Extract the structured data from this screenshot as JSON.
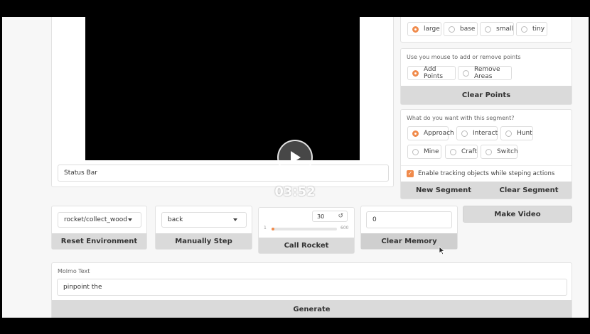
{
  "video": {
    "time": "03:52",
    "play_icon": "play-icon"
  },
  "status": {
    "placeholder_text": "Status Bar"
  },
  "model_size": {
    "options": [
      {
        "label": "large",
        "selected": true
      },
      {
        "label": "base",
        "selected": false
      },
      {
        "label": "small",
        "selected": false
      },
      {
        "label": "tiny",
        "selected": false
      }
    ]
  },
  "points": {
    "label": "Use you mouse to add or remove points",
    "options": [
      {
        "label": "Add Points",
        "selected": true
      },
      {
        "label": "Remove Areas",
        "selected": false
      }
    ],
    "clear_label": "Clear Points"
  },
  "segment_action": {
    "label": "What do you want with this segment?",
    "options": [
      {
        "label": "Approach",
        "selected": true
      },
      {
        "label": "Interact",
        "selected": false
      },
      {
        "label": "Hunt",
        "selected": false
      },
      {
        "label": "Mine",
        "selected": false
      },
      {
        "label": "Craft",
        "selected": false
      },
      {
        "label": "Switch",
        "selected": false
      }
    ],
    "tracking_label": "Enable tracking objects while steping actions",
    "tracking_checked": true,
    "new_segment_label": "New Segment",
    "clear_segment_label": "Clear Segment"
  },
  "controls": {
    "environment_value": "rocket/collect_wood",
    "reset_label": "Reset Environment",
    "step_value": "back",
    "step_label": "Manually Step",
    "rocket_number": "30",
    "slider_min": "1",
    "slider_max": "600",
    "slider_fraction": 0.0,
    "call_rocket_label": "Call Rocket",
    "memory_value": "0",
    "clear_memory_label": "Clear Memory",
    "make_video_label": "Make Video"
  },
  "molmo": {
    "label": "Molmo Text",
    "value": "pinpoint the",
    "generate_label": "Generate"
  },
  "colors": {
    "accent": "#f08a4b",
    "button_grey": "#dadada"
  }
}
